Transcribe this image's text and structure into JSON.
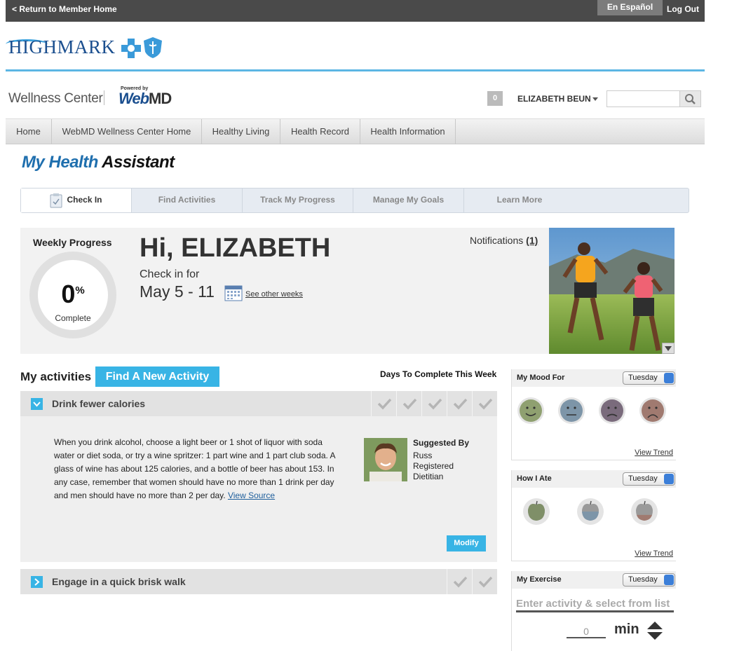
{
  "topbar": {
    "return_label": "< Return to Member Home",
    "espanol_label": "En Español",
    "logout_label": "Log Out"
  },
  "brand": {
    "name": "HIGHMARK",
    "reg": "."
  },
  "header": {
    "wellness_title": "Wellness Center",
    "powered_by": "Powered by",
    "webmd_web": "Web",
    "webmd_md": "MD",
    "counter": "0",
    "username": "ELIZABETH BEUN",
    "search_placeholder": ""
  },
  "nav": {
    "items": [
      {
        "label": "Home"
      },
      {
        "label": "WebMD Wellness Center Home"
      },
      {
        "label": "Healthy Living"
      },
      {
        "label": "Health Record"
      },
      {
        "label": "Health Information"
      }
    ]
  },
  "page": {
    "title_a": "My Health",
    "title_b": "Assistant"
  },
  "subtabs": [
    {
      "label": "Check In",
      "active": true
    },
    {
      "label": "Find Activities"
    },
    {
      "label": "Track My Progress"
    },
    {
      "label": "Manage My Goals"
    },
    {
      "label": "Learn More"
    }
  ],
  "progress": {
    "weekly_label": "Weekly Progress",
    "percent": "0",
    "percent_sign": "%",
    "complete_label": "Complete",
    "greeting": "Hi, ELIZABETH",
    "checkin_label": "Check in for",
    "date_range": "May 5 - 11",
    "other_weeks_label": "See other weeks",
    "notifications_label": "Notifications",
    "notifications_count": "(1)"
  },
  "activities": {
    "heading": "My activities",
    "find_new_label": "Find A New Activity",
    "days_label": "Days To Complete This Week",
    "items": [
      {
        "name": "Drink fewer calories",
        "description": "When you drink alcohol, choose a light beer or 1 shot of liquor with soda water or diet soda, or try a wine spritzer: 1 part wine and 1 part club soda. A glass of wine has about 125 calories, and a bottle of beer has about 153. In any case, remember that women should have no more than 1 drink per day and men should have no more than 2 per day.",
        "source_label": "View Source",
        "suggested_by_label": "Suggested By",
        "suggested_by_name": "Russ Registered Dietitian",
        "modify_label": "Modify",
        "days": 5
      },
      {
        "name": "Engage in a quick brisk walk",
        "days": 2
      }
    ]
  },
  "mood": {
    "title": "My Mood For",
    "day": "Tuesday",
    "trend_label": "View Trend",
    "faces": [
      "happy-face-icon",
      "neutral-face-icon",
      "sad-face-icon",
      "very-sad-face-icon"
    ],
    "colors": [
      "#8fa070",
      "#7d95a8",
      "#7a6b7c",
      "#a07a70"
    ]
  },
  "ate": {
    "title": "How I Ate",
    "day": "Tuesday",
    "trend_label": "View Trend",
    "colors": [
      "#7f8f68",
      "#7d95a8",
      "#a07a70"
    ]
  },
  "exercise": {
    "title": "My Exercise",
    "day": "Tuesday",
    "input_placeholder": "Enter activity & select from list",
    "minutes": "0",
    "unit": "min"
  }
}
